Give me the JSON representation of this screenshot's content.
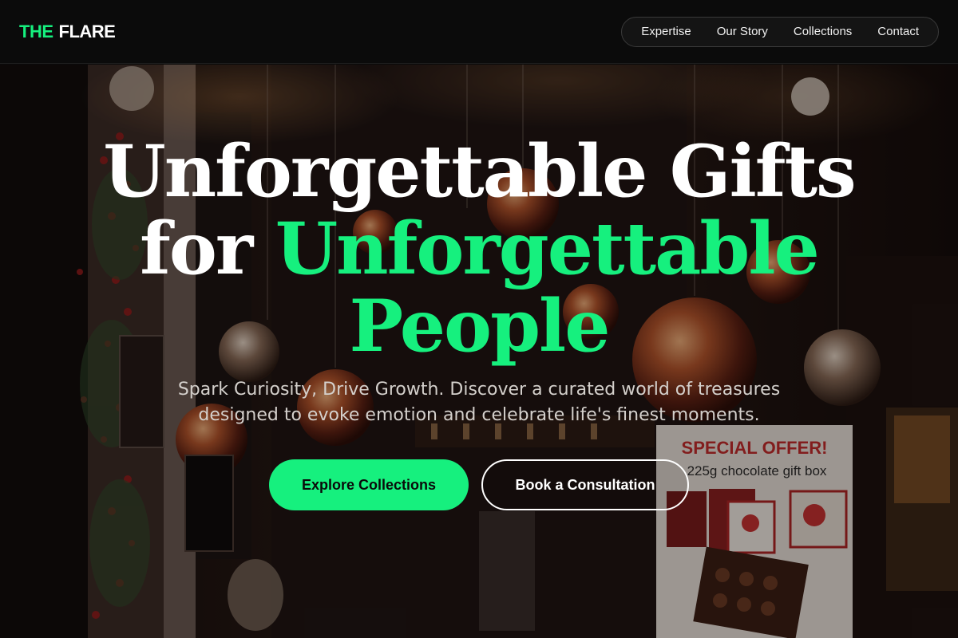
{
  "header": {
    "logo_part1": "THE",
    "logo_part2": "FLARE",
    "nav": [
      "Expertise",
      "Our Story",
      "Collections",
      "Contact"
    ]
  },
  "hero": {
    "headline_line1": "Unforgettable Gifts",
    "headline_for": "for",
    "headline_accent1": "Unforgettable",
    "headline_accent2": "People",
    "subtitle": "Spark Curiosity, Drive Growth. Discover a curated world of treasures designed to evoke emotion and celebrate life's finest moments.",
    "primary_cta": "Explore Collections",
    "secondary_cta": "Book a Consultation",
    "background_image": "christmas-shop-window-photo",
    "sign_title": "SPECIAL OFFER!",
    "sign_text": "225g chocolate gift box"
  },
  "colors": {
    "accent": "#16f07e",
    "background": "#0b0b0b",
    "text": "#ffffff"
  }
}
